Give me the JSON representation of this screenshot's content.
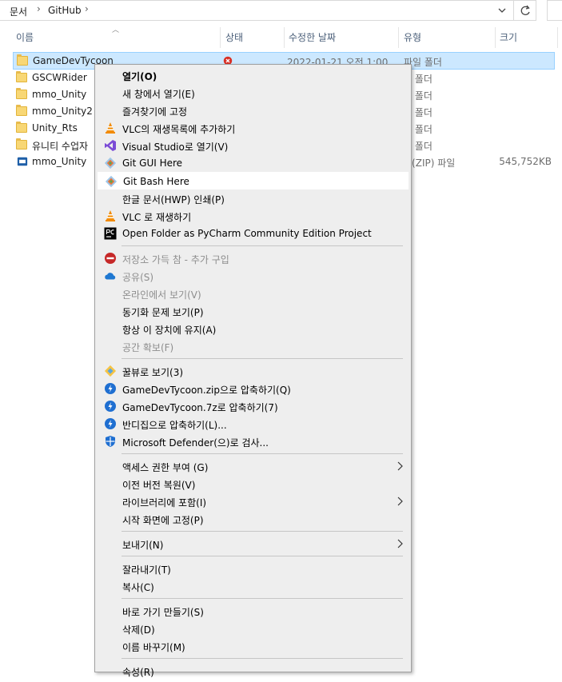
{
  "address_bar": {
    "crumbs": [
      "문서",
      "GitHub"
    ],
    "separator": "›"
  },
  "columns": {
    "name": "이름",
    "status": "상태",
    "modified": "수정한 날짜",
    "type": "유형",
    "size": "크기"
  },
  "files": [
    {
      "name": "GameDevTycoon",
      "modified": "2022-01-21 오전 1:00",
      "type": "파일 폴더",
      "size": "",
      "icon": "folder-icon",
      "status": "error-icon",
      "selected": true
    },
    {
      "name": "GSCWRider",
      "modified": "",
      "type": "일 폴더",
      "size": "",
      "icon": "folder-icon"
    },
    {
      "name": "mmo_Unity",
      "modified": "",
      "type": "일 폴더",
      "size": "",
      "icon": "folder-icon"
    },
    {
      "name": "mmo_Unity2",
      "modified": "",
      "type": "일 폴더",
      "size": "",
      "icon": "folder-icon"
    },
    {
      "name": "Unity_Rts",
      "modified": "",
      "type": "일 폴더",
      "size": "",
      "icon": "folder-icon"
    },
    {
      "name": "유니티 수업자",
      "modified": "",
      "type": "일 폴더",
      "size": "",
      "icon": "folder-icon"
    },
    {
      "name": "mmo_Unity",
      "modified": "",
      "type": "축(ZIP) 파일",
      "size": "545,752KB",
      "icon": "zip-icon"
    }
  ],
  "context_menu": {
    "items": [
      {
        "label": "열기(O)",
        "bold": true
      },
      {
        "label": "새 창에서 열기(E)"
      },
      {
        "label": "즐겨찾기에 고정"
      },
      {
        "label": "VLC의 재생목록에 추가하기",
        "icon": "vlc-icon"
      },
      {
        "label": "Visual Studio로 열기(V)",
        "icon": "visual-studio-icon"
      },
      {
        "label": "Git GUI Here",
        "icon": "git-icon"
      },
      {
        "label": "Git Bash Here",
        "icon": "git-icon",
        "hover": true
      },
      {
        "label": "한글 문서(HWP) 인쇄(P)"
      },
      {
        "label": "VLC 로 재생하기",
        "icon": "vlc-icon"
      },
      {
        "label": "Open Folder as PyCharm Community Edition Project",
        "icon": "pycharm-icon"
      },
      {
        "separator": true
      },
      {
        "label": "저장소 가득 참 - 추가 구입",
        "icon": "no-entry-icon",
        "disabled": true
      },
      {
        "label": "공유(S)",
        "icon": "onedrive-cloud-icon",
        "disabled": true
      },
      {
        "label": "온라인에서 보기(V)",
        "disabled": true
      },
      {
        "label": "동기화 문제 보기(P)"
      },
      {
        "label": "항상 이 장치에 유지(A)"
      },
      {
        "label": "공간 확보(F)",
        "disabled": true
      },
      {
        "separator": true
      },
      {
        "label": "꿀뷰로 보기(3)",
        "icon": "honeyview-icon"
      },
      {
        "label": "GameDevTycoon.zip으로 압축하기(Q)",
        "icon": "bandizip-icon"
      },
      {
        "label": "GameDevTycoon.7z로 압축하기(7)",
        "icon": "bandizip-icon"
      },
      {
        "label": "반디집으로 압축하기(L)...",
        "icon": "bandizip-icon"
      },
      {
        "label": "Microsoft Defender(으)로 검사...",
        "icon": "defender-shield-icon"
      },
      {
        "separator": true
      },
      {
        "label": "액세스 권한 부여 (G)",
        "submenu": true
      },
      {
        "label": "이전 버전 복원(V)"
      },
      {
        "label": "라이브러리에 포함(I)",
        "submenu": true
      },
      {
        "label": "시작 화면에 고정(P)"
      },
      {
        "separator": true
      },
      {
        "label": "보내기(N)",
        "submenu": true
      },
      {
        "separator": true
      },
      {
        "label": "잘라내기(T)"
      },
      {
        "label": "복사(C)"
      },
      {
        "separator": true
      },
      {
        "label": "바로 가기 만들기(S)"
      },
      {
        "label": "삭제(D)"
      },
      {
        "label": "이름 바꾸기(M)"
      },
      {
        "separator": true
      },
      {
        "label": "속성(R)"
      }
    ]
  },
  "colors": {
    "selection_bg": "#cce8ff",
    "selection_border": "#99d1ff",
    "menu_bg": "#eeeeee",
    "disabled_text": "#8d8d8d"
  }
}
